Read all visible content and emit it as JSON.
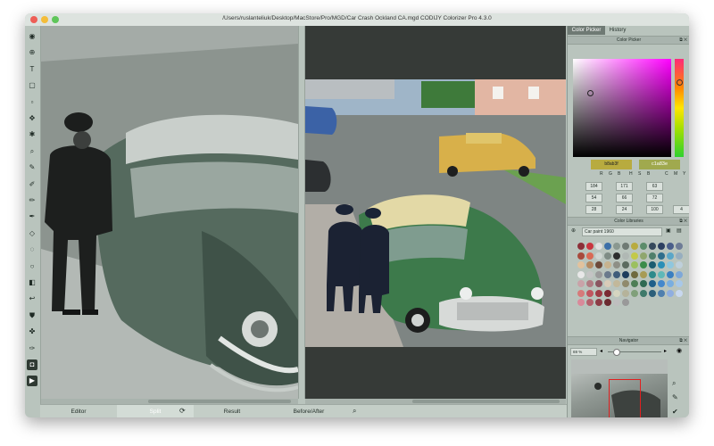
{
  "window": {
    "title": "/Users/ruslanteliuk/Desktop/MacStore/Pro/MGD/Car Crash Ockland CA.mgd CODIJY Colorizer Pro 4.3.0"
  },
  "toolbar": {
    "tools": [
      {
        "name": "brush-round-icon",
        "glyph": "◉",
        "selected": false
      },
      {
        "name": "target-icon",
        "glyph": "⊕",
        "selected": false
      },
      {
        "name": "text-tool-icon",
        "glyph": "T",
        "selected": false
      },
      {
        "name": "frame-icon",
        "glyph": "▢",
        "selected": false
      },
      {
        "name": "faint-tool-icon",
        "glyph": "▫",
        "selected": false
      },
      {
        "name": "marker-icon",
        "glyph": "✥",
        "selected": false
      },
      {
        "name": "star-icon",
        "glyph": "✱",
        "selected": false
      },
      {
        "name": "zoom-icon",
        "glyph": "⌕",
        "selected": false
      },
      {
        "name": "pen-icon",
        "glyph": "✎",
        "selected": false
      },
      {
        "name": "dropper-icon",
        "glyph": "✐",
        "selected": false
      },
      {
        "name": "pencil-icon",
        "glyph": "✏",
        "selected": false
      },
      {
        "name": "brush-icon",
        "glyph": "✒",
        "selected": false
      },
      {
        "name": "eraser-icon",
        "glyph": "◇",
        "selected": false
      },
      {
        "name": "lasso-icon",
        "glyph": "◌",
        "selected": false
      },
      {
        "name": "faint-circle-icon",
        "glyph": "○",
        "selected": false
      },
      {
        "name": "fill-icon",
        "glyph": "◧",
        "selected": false
      },
      {
        "name": "undo-icon",
        "glyph": "↩",
        "selected": false
      },
      {
        "name": "bucket-icon",
        "glyph": "⛊",
        "selected": false
      },
      {
        "name": "stamp-icon",
        "glyph": "✤",
        "selected": false
      },
      {
        "name": "smudge-icon",
        "glyph": "✑",
        "selected": false
      },
      {
        "name": "view-icon",
        "glyph": "◘",
        "selected": true
      },
      {
        "name": "play-icon",
        "glyph": "▶",
        "selected": true
      }
    ]
  },
  "bottombar": {
    "tabs": [
      {
        "label": "Editor",
        "active": false
      },
      {
        "label": "Split",
        "active": true
      },
      {
        "label": "Result",
        "active": false
      },
      {
        "label": "Before/After",
        "active": false
      }
    ]
  },
  "panel": {
    "tabs": [
      {
        "label": "Color Picker",
        "active": true
      },
      {
        "label": "History",
        "active": false
      }
    ],
    "color_picker": {
      "header": "Color Picker",
      "current_hex": "b8ab3f",
      "current_color": "#b8ab3f",
      "rgb_tab": "c1a83e",
      "channels": {
        "labels": [
          "R",
          "G",
          "B",
          "H",
          "S",
          "B",
          "C",
          "M",
          "Y",
          "K"
        ],
        "values": [
          [
            "184",
            "171",
            "63"
          ],
          [
            "54",
            "66",
            "72"
          ],
          [
            "28",
            "24",
            "100",
            "4"
          ]
        ]
      }
    },
    "color_libraries": {
      "header": "Color Libraries",
      "selected": "Car paint 1960"
    },
    "navigator": {
      "header": "Navigator",
      "zoom": "69 %",
      "zoom_level": 0.1
    }
  }
}
